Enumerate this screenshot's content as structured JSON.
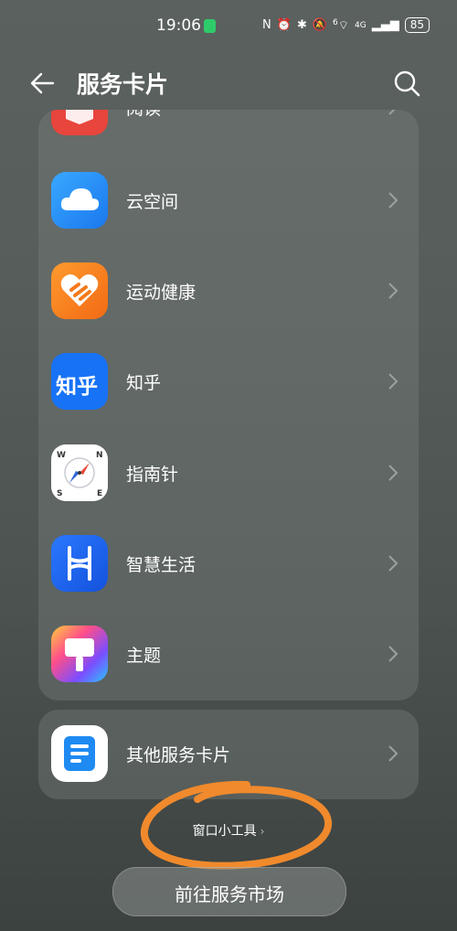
{
  "status_bar": {
    "time": "19:06",
    "icons": [
      "nfc-icon",
      "alarm-icon",
      "bluetooth-icon",
      "mute-icon",
      "wifi-icon",
      "signal-icon"
    ],
    "network": "4G",
    "wifi_label": "6",
    "battery": "85"
  },
  "header": {
    "title": "服务卡片"
  },
  "apps": [
    {
      "label": "阅读",
      "icon": "reading-app-icon",
      "color": "#e8453c"
    },
    {
      "label": "云空间",
      "icon": "cloud-app-icon",
      "color": "#2f8ff5"
    },
    {
      "label": "运动健康",
      "icon": "health-app-icon",
      "color": "#f57a1a"
    },
    {
      "label": "知乎",
      "icon": "zhihu-app-icon",
      "color": "#1772f6",
      "glyph": "知乎"
    },
    {
      "label": "指南针",
      "icon": "compass-app-icon",
      "color": "#ffffff"
    },
    {
      "label": "智慧生活",
      "icon": "smart-life-app-icon",
      "color": "#1e64f0"
    },
    {
      "label": "主题",
      "icon": "themes-app-icon",
      "color": "#7b4dff"
    }
  ],
  "other": {
    "label": "其他服务卡片",
    "icon": "other-cards-app-icon"
  },
  "tools": {
    "label": "窗口小工具"
  },
  "market_button": {
    "label": "前往服务市场"
  },
  "colors": {
    "annotation": "#f08a2c",
    "background": "#575d5b"
  }
}
